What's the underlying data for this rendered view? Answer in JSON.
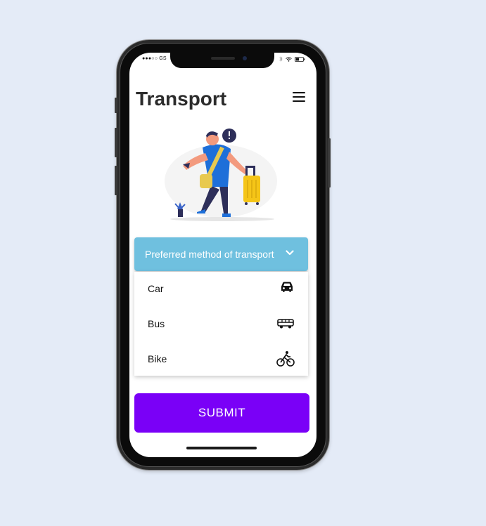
{
  "status_bar": {
    "carrier": "●●●○○ GS",
    "icons": [
      "bluetooth-icon",
      "wifi-icon",
      "battery-icon"
    ]
  },
  "header": {
    "title": "Transport",
    "menu_icon": "hamburger-menu-icon"
  },
  "dropdown": {
    "label": "Preferred method of transport",
    "icon": "chevron-down-icon",
    "options": [
      {
        "label": "Car",
        "icon": "car-icon"
      },
      {
        "label": "Bus",
        "icon": "bus-icon"
      },
      {
        "label": "Bike",
        "icon": "bicycle-icon"
      }
    ]
  },
  "submit": {
    "label": "SUBMIT"
  },
  "colors": {
    "background": "#e4ebf7",
    "dropdown_header": "#6fc0df",
    "submit_button": "#7a00f7",
    "title_text": "#2c2c2c"
  }
}
